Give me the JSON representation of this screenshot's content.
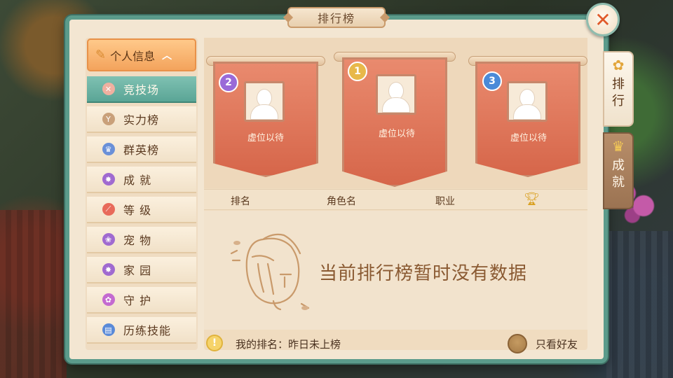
{
  "window": {
    "title": "排行榜",
    "close_glyph": "✕"
  },
  "menu": {
    "header": {
      "label": "个人信息",
      "icon": "feather-icon",
      "expanded": true
    },
    "items": [
      {
        "label": "竞技场",
        "icon": "crossed-swords-icon",
        "color": "#f0b0a0",
        "active": true
      },
      {
        "label": "实力榜",
        "icon": "power-icon",
        "color": "#c9a07a"
      },
      {
        "label": "群英榜",
        "icon": "crown-icon",
        "color": "#6a90d8"
      },
      {
        "label": "成  就",
        "icon": "medal-icon",
        "color": "#a06ad0"
      },
      {
        "label": "等  级",
        "icon": "level-icon",
        "color": "#e86a5a"
      },
      {
        "label": "宠  物",
        "icon": "paw-icon",
        "color": "#a06ad0"
      },
      {
        "label": "家  园",
        "icon": "home-icon",
        "color": "#a06ad0"
      },
      {
        "label": "守  护",
        "icon": "guard-icon",
        "color": "#c46ad0"
      },
      {
        "label": "历练技能",
        "icon": "book-icon",
        "color": "#5a8ad8"
      }
    ]
  },
  "podium": [
    {
      "rank": "2",
      "name": "虚位以待",
      "badge_color": "#9a6ad8"
    },
    {
      "rank": "1",
      "name": "虚位以待",
      "badge_color": "#e8b84a"
    },
    {
      "rank": "3",
      "name": "虚位以待",
      "badge_color": "#4a8ad8"
    }
  ],
  "table": {
    "columns": [
      "排名",
      "角色名",
      "职业"
    ],
    "score_icon": "trophy-icon"
  },
  "empty_message": "当前排行榜暂时没有数据",
  "footer": {
    "my_rank_label": "我的排名：",
    "my_rank_value": "昨日未上榜",
    "friends_only": "只看好友"
  },
  "side_tabs": [
    {
      "label_1": "排",
      "label_2": "行",
      "active": true,
      "icon": "ranking-flower-icon"
    },
    {
      "label_1": "成",
      "label_2": "就",
      "active": false,
      "icon": "trophy-cup-icon"
    }
  ]
}
